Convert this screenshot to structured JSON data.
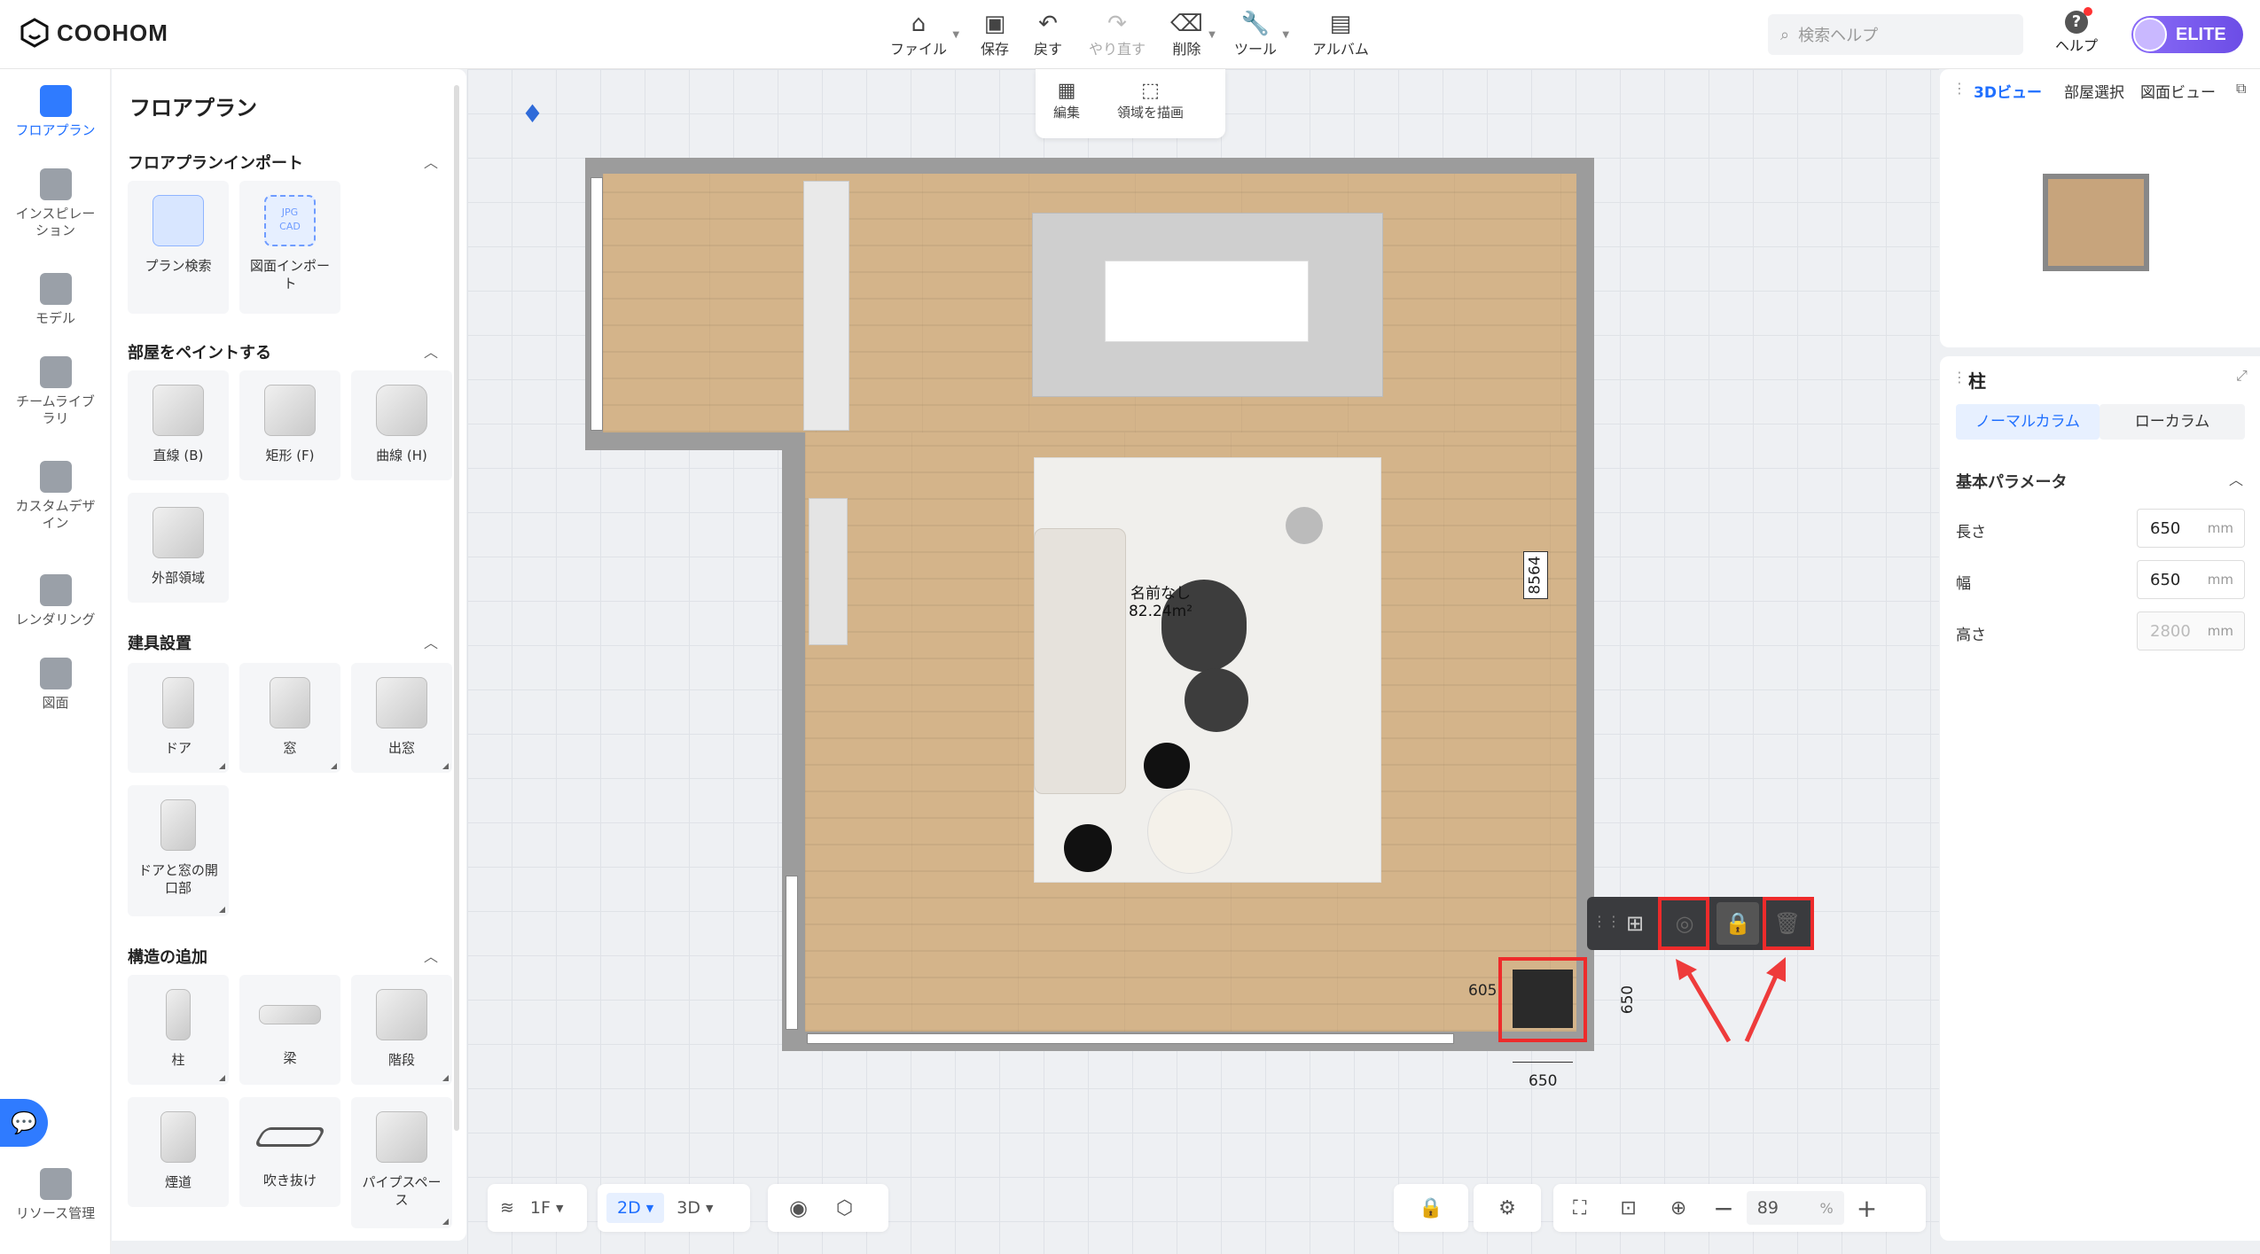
{
  "app": {
    "logo_text": "COOHOM"
  },
  "toolbar": {
    "file": "ファイル",
    "save": "保存",
    "undo": "戻す",
    "redo": "やり直す",
    "delete": "削除",
    "tools": "ツール",
    "album": "アルバム"
  },
  "search": {
    "placeholder": "検索ヘルプ"
  },
  "help": {
    "label": "ヘルプ"
  },
  "account": {
    "badge": "ELITE"
  },
  "edit_bar": {
    "edit": "編集",
    "draw_area": "領域を描画"
  },
  "leftnav": [
    {
      "label": "フロアプラン",
      "active": true
    },
    {
      "label": "インスピレー ション"
    },
    {
      "label": "モデル"
    },
    {
      "label": "チームライブ ラリ"
    },
    {
      "label": "カスタムデザ イン"
    },
    {
      "label": "レンダリング"
    },
    {
      "label": "図面"
    },
    {
      "label": "リソース管理"
    }
  ],
  "panel": {
    "title": "フロアプラン",
    "sections": [
      {
        "title": "フロアプランインポート",
        "items": [
          "プラン検索",
          "図面インポー ト"
        ]
      },
      {
        "title": "部屋をペイントする",
        "items": [
          "直線 (B)",
          "矩形 (F)",
          "曲線 (H)",
          "外部領域"
        ]
      },
      {
        "title": "建具設置",
        "items": [
          "ドア",
          "窓",
          "出窓",
          "ドアと窓の開 口部"
        ]
      },
      {
        "title": "構造の追加",
        "items": [
          "柱",
          "梁",
          "階段",
          "煙道",
          "吹き抜け",
          "パイプスペー ス"
        ]
      }
    ],
    "import_tags": {
      "jpg": "JPG",
      "cad": "CAD"
    }
  },
  "floorplan": {
    "room_name": "名前なし",
    "room_area": "82.24m²",
    "dim_height": "8564",
    "dim_col_left": "605",
    "dim_col_height": "650",
    "dim_col_width": "650"
  },
  "right": {
    "tabs": [
      "3Dビュー",
      "部屋選択",
      "図面ビュー"
    ],
    "prop_title": "柱",
    "col_tabs": [
      "ノーマルカラム",
      "ローカラム"
    ],
    "section": "基本パラメータ",
    "params": [
      {
        "label": "長さ",
        "value": "650",
        "unit": "mm"
      },
      {
        "label": "幅",
        "value": "650",
        "unit": "mm"
      },
      {
        "label": "高さ",
        "value": "2800",
        "unit": "mm"
      }
    ]
  },
  "bottom": {
    "floor": "1F",
    "mode2d": "2D",
    "mode3d": "3D",
    "zoom": "89",
    "zoom_unit": "%"
  },
  "colors": {
    "accent": "#1f6fff",
    "highlight": "#ee2b2b"
  }
}
